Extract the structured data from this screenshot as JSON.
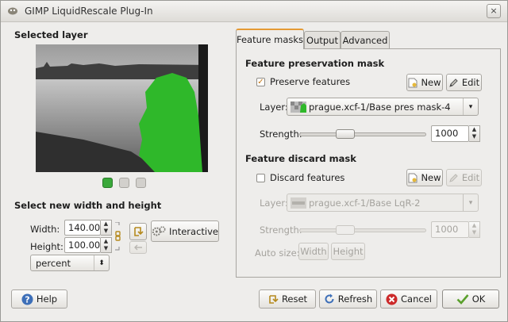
{
  "window": {
    "title": "GIMP LiquidRescale Plug-In",
    "close_glyph": "×"
  },
  "left": {
    "selected_layer_heading": "Selected layer",
    "size_heading": "Select new width and height",
    "width_label": "Width:",
    "width_value": "140.00",
    "height_label": "Height:",
    "height_value": "100.00",
    "unit_value": "percent",
    "interactive_label": "Interactive"
  },
  "tabs": [
    {
      "label": "Feature masks",
      "active": true
    },
    {
      "label": "Output",
      "active": false
    },
    {
      "label": "Advanced",
      "active": false
    }
  ],
  "preservation": {
    "heading": "Feature preservation mask",
    "checkbox_label": "Preserve features",
    "checked": true,
    "new_label": "New",
    "edit_label": "Edit",
    "layer_label": "Layer:",
    "layer_value": "prague.xcf-1/Base pres mask-4",
    "strength_label": "Strength:",
    "strength_value": "1000"
  },
  "discard": {
    "heading": "Feature discard mask",
    "checkbox_label": "Discard features",
    "checked": false,
    "new_label": "New",
    "edit_label": "Edit",
    "layer_label": "Layer:",
    "layer_value": "prague.xcf-1/Base LqR-2",
    "strength_label": "Strength:",
    "strength_value": "1000",
    "autosize_label": "Auto size:",
    "width_button": "Width",
    "height_button": "Height"
  },
  "footer": {
    "help": "Help",
    "reset": "Reset",
    "refresh": "Refresh",
    "cancel": "Cancel",
    "ok": "OK"
  },
  "colors": {
    "accent": "#e59a34",
    "mask_green": "#2fb82a"
  }
}
